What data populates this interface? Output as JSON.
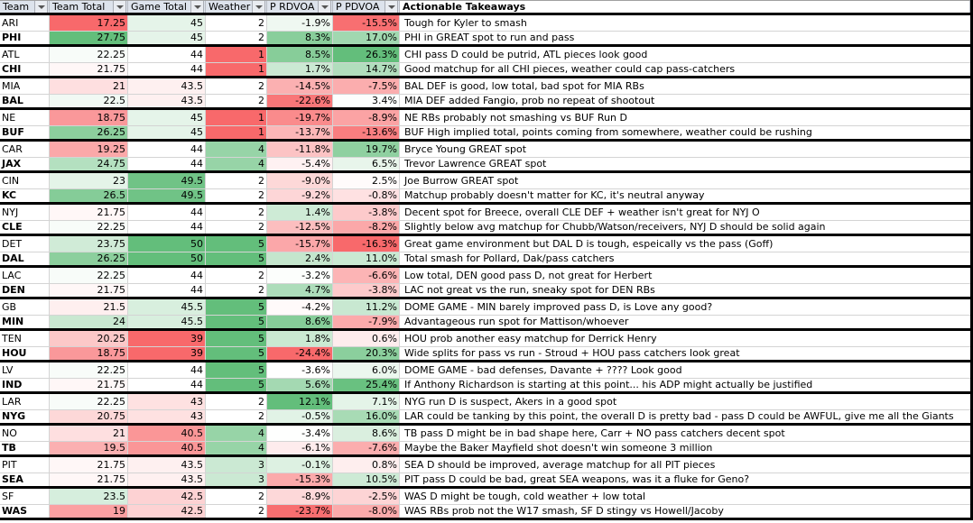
{
  "colors": {
    "low": "#F8696B",
    "mid": "#FFFFFF",
    "high": "#63BE7B"
  },
  "headers": [
    "Team",
    "Team Total",
    "Game Total",
    "Weather",
    "P RDVOA",
    "P PDVOA",
    "Actionable Takeaways"
  ],
  "scales": {
    "team_total": {
      "min": 17.25,
      "mid": 22.0,
      "max": 27.75
    },
    "game_total": {
      "min": 39,
      "mid": 44,
      "max": 50
    },
    "weather": {
      "min": 1,
      "mid": 2,
      "max": 5
    },
    "rdvoa": {
      "min": -24.4,
      "mid": -3.5,
      "max": 12.1
    },
    "pdvoa": {
      "min": -16.3,
      "mid": 3.0,
      "max": 26.3
    }
  },
  "rows": [
    {
      "team": "ARI",
      "team_total": "17.25",
      "game_total": "45",
      "weather": "2",
      "rdvoa": "-1.9%",
      "pdvoa": "-15.5%",
      "takeaway": "Tough for Kyler to smash"
    },
    {
      "team": "PHI",
      "team_total": "27.75",
      "game_total": "45",
      "weather": "2",
      "rdvoa": "8.3%",
      "pdvoa": "17.0%",
      "takeaway": "PHI in GREAT spot to run and pass"
    },
    {
      "team": "ATL",
      "team_total": "22.25",
      "game_total": "44",
      "weather": "1",
      "rdvoa": "8.5%",
      "pdvoa": "26.3%",
      "takeaway": "CHI pass D could be putrid, ATL pieces look good"
    },
    {
      "team": "CHI",
      "team_total": "21.75",
      "game_total": "44",
      "weather": "1",
      "rdvoa": "1.7%",
      "pdvoa": "14.7%",
      "takeaway": "Good matchup for all CHI pieces, weather could cap pass-catchers"
    },
    {
      "team": "MIA",
      "team_total": "21",
      "game_total": "43.5",
      "weather": "2",
      "rdvoa": "-14.5%",
      "pdvoa": "-7.5%",
      "takeaway": "BAL DEF is good, low total, bad spot for MIA RBs"
    },
    {
      "team": "BAL",
      "team_total": "22.5",
      "game_total": "43.5",
      "weather": "2",
      "rdvoa": "-22.6%",
      "pdvoa": "3.4%",
      "takeaway": "MIA DEF added Fangio, prob no repeat of shootout"
    },
    {
      "team": "NE",
      "team_total": "18.75",
      "game_total": "45",
      "weather": "1",
      "rdvoa": "-19.7%",
      "pdvoa": "-8.9%",
      "takeaway": "NE RBs probably not smashing vs BUF Run D"
    },
    {
      "team": "BUF",
      "team_total": "26.25",
      "game_total": "45",
      "weather": "1",
      "rdvoa": "-13.7%",
      "pdvoa": "-13.6%",
      "takeaway": "BUF High implied total, points coming from somewhere, weather could be rushing"
    },
    {
      "team": "CAR",
      "team_total": "19.25",
      "game_total": "44",
      "weather": "4",
      "rdvoa": "-11.8%",
      "pdvoa": "19.7%",
      "takeaway": "Bryce Young GREAT spot"
    },
    {
      "team": "JAX",
      "team_total": "24.75",
      "game_total": "44",
      "weather": "4",
      "rdvoa": "-5.4%",
      "pdvoa": "6.5%",
      "takeaway": "Trevor Lawrence GREAT spot"
    },
    {
      "team": "CIN",
      "team_total": "23",
      "game_total": "49.5",
      "weather": "2",
      "rdvoa": "-9.0%",
      "pdvoa": "2.5%",
      "takeaway": "Joe Burrow GREAT spot"
    },
    {
      "team": "KC",
      "team_total": "26.5",
      "game_total": "49.5",
      "weather": "2",
      "rdvoa": "-9.2%",
      "pdvoa": "-0.8%",
      "takeaway": "Matchup probably doesn't matter for KC, it's neutral anyway"
    },
    {
      "team": "NYJ",
      "team_total": "21.75",
      "game_total": "44",
      "weather": "2",
      "rdvoa": "1.4%",
      "pdvoa": "-3.8%",
      "takeaway": "Decent spot for Breece, overall CLE DEF + weather isn't great for NYJ O"
    },
    {
      "team": "CLE",
      "team_total": "22.25",
      "game_total": "44",
      "weather": "2",
      "rdvoa": "-12.5%",
      "pdvoa": "-8.2%",
      "takeaway": "Slightly below avg matchup for Chubb/Watson/receivers, NYJ D should be solid again"
    },
    {
      "team": "DET",
      "team_total": "23.75",
      "game_total": "50",
      "weather": "5",
      "rdvoa": "-15.7%",
      "pdvoa": "-16.3%",
      "takeaway": "Great game environment but DAL D is tough, espeically vs the pass (Goff)"
    },
    {
      "team": "DAL",
      "team_total": "26.25",
      "game_total": "50",
      "weather": "5",
      "rdvoa": "2.4%",
      "pdvoa": "11.0%",
      "takeaway": "Total smash for Pollard, Dak/pass catchers"
    },
    {
      "team": "LAC",
      "team_total": "22.25",
      "game_total": "44",
      "weather": "2",
      "rdvoa": "-3.2%",
      "pdvoa": "-6.6%",
      "takeaway": "Low total, DEN good pass D, not great for Herbert"
    },
    {
      "team": "DEN",
      "team_total": "21.75",
      "game_total": "44",
      "weather": "2",
      "rdvoa": "4.7%",
      "pdvoa": "-3.8%",
      "takeaway": "LAC not great vs the run, sneaky spot for DEN RBs"
    },
    {
      "team": "GB",
      "team_total": "21.5",
      "game_total": "45.5",
      "weather": "5",
      "rdvoa": "-4.2%",
      "pdvoa": "11.2%",
      "takeaway": "DOME GAME - MIN barely improved pass D, is Love any good?"
    },
    {
      "team": "MIN",
      "team_total": "24",
      "game_total": "45.5",
      "weather": "5",
      "rdvoa": "8.6%",
      "pdvoa": "-7.9%",
      "takeaway": "Advantageous run spot for Mattison/whoever"
    },
    {
      "team": "TEN",
      "team_total": "20.25",
      "game_total": "39",
      "weather": "5",
      "rdvoa": "1.8%",
      "pdvoa": "0.6%",
      "takeaway": "HOU prob another easy matchup for Derrick Henry"
    },
    {
      "team": "HOU",
      "team_total": "18.75",
      "game_total": "39",
      "weather": "5",
      "rdvoa": "-24.4%",
      "pdvoa": "20.3%",
      "takeaway": "Wide splits for pass vs run - Stroud + HOU pass catchers look great"
    },
    {
      "team": "LV",
      "team_total": "22.25",
      "game_total": "44",
      "weather": "5",
      "rdvoa": "-3.6%",
      "pdvoa": "6.0%",
      "takeaway": "DOME GAME - bad defenses, Davante + ???? Look good"
    },
    {
      "team": "IND",
      "team_total": "21.75",
      "game_total": "44",
      "weather": "5",
      "rdvoa": "5.6%",
      "pdvoa": "25.4%",
      "takeaway": "If Anthony Richardson is starting at this point... his ADP might actually be justified"
    },
    {
      "team": "LAR",
      "team_total": "22.25",
      "game_total": "43",
      "weather": "2",
      "rdvoa": "12.1%",
      "pdvoa": "7.1%",
      "takeaway": "NYG run D is suspect, Akers in a good spot"
    },
    {
      "team": "NYG",
      "team_total": "20.75",
      "game_total": "43",
      "weather": "2",
      "rdvoa": "-0.5%",
      "pdvoa": "16.0%",
      "takeaway": "LAR could be tanking by this point, the overall D is pretty bad - pass D could be AWFUL, give me all the Giants"
    },
    {
      "team": "NO",
      "team_total": "21",
      "game_total": "40.5",
      "weather": "4",
      "rdvoa": "-3.4%",
      "pdvoa": "8.6%",
      "takeaway": "TB pass D might be in bad shape here, Carr + NO pass catchers decent spot"
    },
    {
      "team": "TB",
      "team_total": "19.5",
      "game_total": "40.5",
      "weather": "4",
      "rdvoa": "-6.1%",
      "pdvoa": "-7.6%",
      "takeaway": "Maybe the Baker Mayfield shot doesn't win someone 3 million"
    },
    {
      "team": "PIT",
      "team_total": "21.75",
      "game_total": "43.5",
      "weather": "3",
      "rdvoa": "-0.1%",
      "pdvoa": "0.8%",
      "takeaway": "SEA D should be improved, average matchup for all PIT pieces"
    },
    {
      "team": "SEA",
      "team_total": "21.75",
      "game_total": "43.5",
      "weather": "3",
      "rdvoa": "-15.3%",
      "pdvoa": "10.5%",
      "takeaway": "PIT pass D could be bad, great SEA weapons, was it a fluke for Geno?"
    },
    {
      "team": "SF",
      "team_total": "23.5",
      "game_total": "42.5",
      "weather": "2",
      "rdvoa": "-8.9%",
      "pdvoa": "-2.5%",
      "takeaway": "WAS D might be tough, cold weather + low total"
    },
    {
      "team": "WAS",
      "team_total": "19",
      "game_total": "42.5",
      "weather": "2",
      "rdvoa": "-23.7%",
      "pdvoa": "-8.0%",
      "takeaway": "WAS RBs prob not the W17 smash, SF D stingy vs Howell/Jacoby"
    }
  ]
}
